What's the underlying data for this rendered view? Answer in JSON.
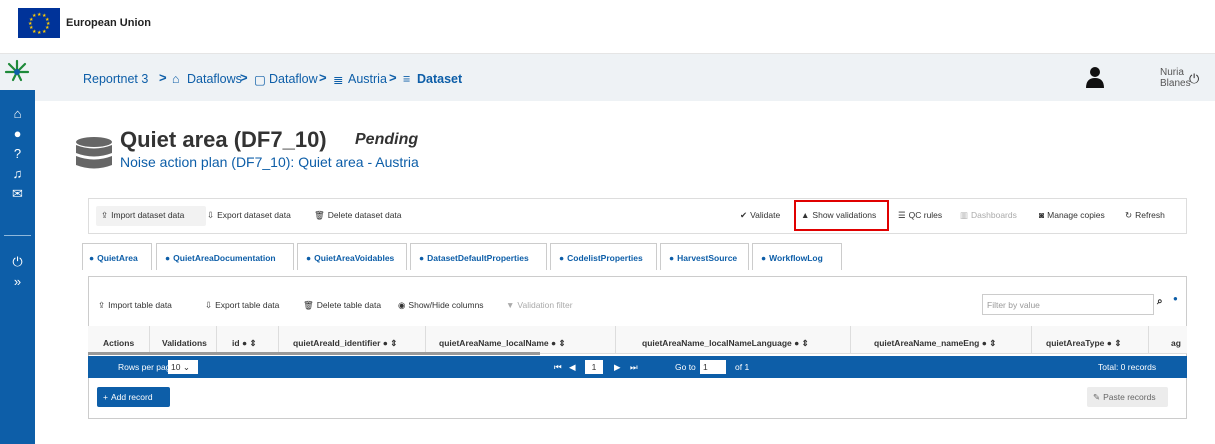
{
  "eu_header": {
    "label": "European Union"
  },
  "breadcrumb": {
    "items": [
      "Reportnet 3",
      "Dataflows",
      "Dataflow",
      "Austria",
      "Dataset"
    ],
    "separator": ">"
  },
  "user": {
    "first_name": "Nuria",
    "last_name": "Blanes"
  },
  "page": {
    "title": "Quiet area (DF7_10)",
    "status": "Pending",
    "subtitle": "Noise action plan (DF7_10): Quiet area - Austria"
  },
  "dataset_toolbar": {
    "import_label": "Import dataset data",
    "export_label": "Export dataset data",
    "delete_label": "Delete dataset data",
    "validate_label": "Validate",
    "show_validations_label": "Show validations",
    "qc_rules_label": "QC rules",
    "dashboards_label": "Dashboards",
    "manage_copies_label": "Manage copies",
    "refresh_label": "Refresh"
  },
  "tabs": [
    "QuietArea",
    "QuietAreaDocumentation",
    "QuietAreaVoidables",
    "DatasetDefaultProperties",
    "CodelistProperties",
    "HarvestSource",
    "WorkflowLog"
  ],
  "table_toolbar": {
    "import_label": "Import table data",
    "export_label": "Export table data",
    "delete_label": "Delete table data",
    "show_hide_label": "Show/Hide columns",
    "validation_filter_label": "Validation filter",
    "filter_placeholder": "Filter by value"
  },
  "table": {
    "columns": [
      "Actions",
      "Validations",
      "id",
      "quietAreaId_identifier",
      "quietAreaName_localName",
      "quietAreaName_localNameLanguage",
      "quietAreaName_nameEng",
      "quietAreaType",
      "ag"
    ]
  },
  "paginator": {
    "rows_per_page_label": "Rows per page",
    "rows_per_page_value": "10",
    "current_page": "1",
    "goto_label": "Go to",
    "goto_value": "1",
    "of_label": "of 1",
    "total_label": "Total: 0 records"
  },
  "actions": {
    "add_record_label": "Add record",
    "paste_records_label": "Paste records"
  },
  "colors": {
    "primary": "#0d5ea8",
    "highlight": "#e00000"
  }
}
